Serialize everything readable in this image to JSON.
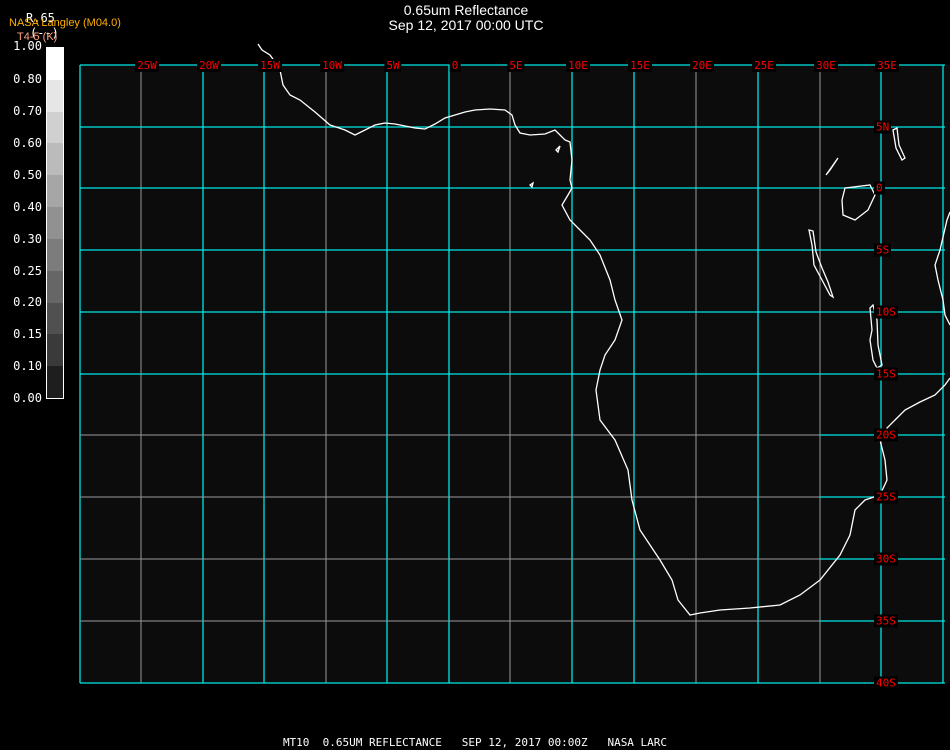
{
  "title": {
    "line1": "0.65um Reflectance",
    "line2": "Sep 12, 2017 00:00 UTC"
  },
  "overlay": {
    "product": "R.65",
    "unit": "(--)",
    "source": "NASA Langley (M04.0)",
    "subtitle": "T4-5 (K)"
  },
  "colorbar": {
    "labels": [
      "1.00",
      "0.80",
      "0.70",
      "0.60",
      "0.50",
      "0.40",
      "0.30",
      "0.25",
      "0.20",
      "0.15",
      "0.10",
      "0.00"
    ],
    "colors": [
      "#ffffff",
      "#e6e6e6",
      "#d0d0d0",
      "#bbbbbb",
      "#a6a6a6",
      "#919191",
      "#7c7c7c",
      "#666666",
      "#505050",
      "#3a3a3a",
      "#1e1e1e"
    ]
  },
  "grid": {
    "lon_labels": [
      "25W",
      "20W",
      "15W",
      "10W",
      "5W",
      "0",
      "5E",
      "10E",
      "15E",
      "20E",
      "25E",
      "30E",
      "35E"
    ],
    "lat_labels": [
      "5N",
      "0",
      "5S",
      "10S",
      "15S",
      "20S",
      "25S",
      "30S",
      "35S",
      "40S"
    ],
    "grid_color": "#00e5e5",
    "grid_minor_color": "#9a9a9a",
    "label_color": "#ff0000",
    "coast_color": "#ffffff"
  },
  "footer": "MT10  0.65UM REFLECTANCE   SEP 12, 2017 00:00Z   NASA LARC"
}
